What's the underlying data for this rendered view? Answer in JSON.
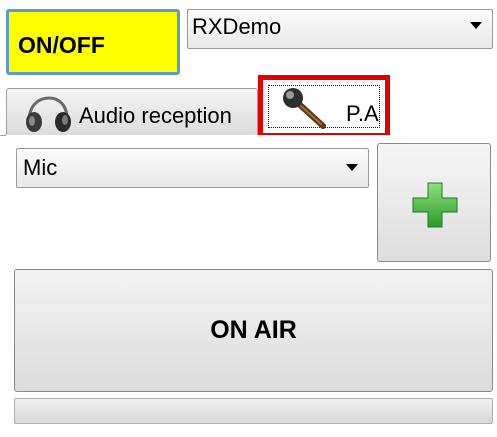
{
  "power": {
    "label": "ON/OFF",
    "color": "#ffff00"
  },
  "device": {
    "selected": "RXDemo"
  },
  "tabs": [
    {
      "label": "Audio reception",
      "icon": "headphones-icon",
      "selected": false
    },
    {
      "label": "P.A",
      "icon": "microphone-icon",
      "selected": true,
      "highlight_color": "#e00000"
    }
  ],
  "pa": {
    "source": {
      "selected": "Mic"
    },
    "add_button": {
      "icon": "plus-icon",
      "icon_color": "#3cb83c"
    },
    "on_air": {
      "label": "ON AIR"
    },
    "level": {
      "value": 0
    }
  }
}
